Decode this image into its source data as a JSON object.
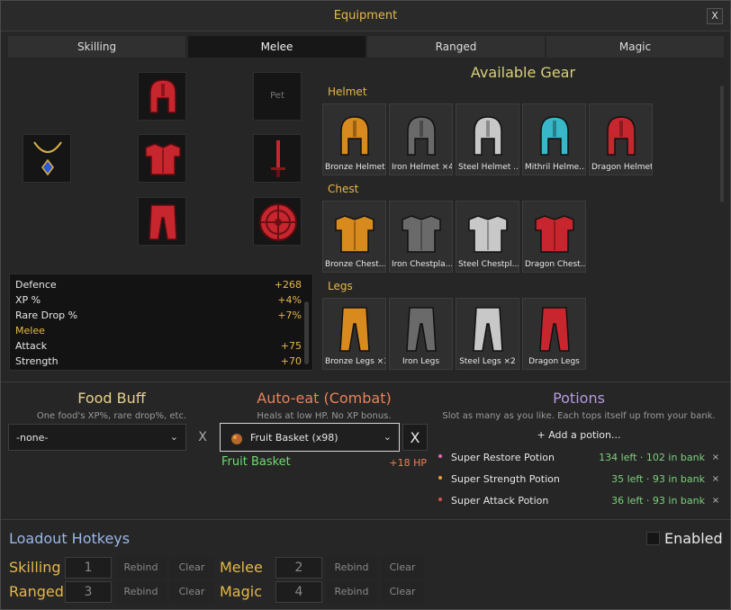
{
  "window": {
    "title": "Equipment",
    "close_label": "X"
  },
  "tabs": [
    "Skilling",
    "Melee",
    "Ranged",
    "Magic"
  ],
  "active_tab": "Melee",
  "equipped": {
    "pet_label": "Pet"
  },
  "stats": [
    {
      "label": "Defence",
      "value": "+268",
      "highlight": false
    },
    {
      "label": "XP %",
      "value": "+4%",
      "highlight": false
    },
    {
      "label": "Rare Drop %",
      "value": "+7%",
      "highlight": false
    },
    {
      "label": "Melee",
      "value": "",
      "highlight": true
    },
    {
      "label": "Attack",
      "value": "+75",
      "highlight": false
    },
    {
      "label": "Strength",
      "value": "+70",
      "highlight": false
    }
  ],
  "available_gear": {
    "title": "Available Gear",
    "categories": [
      {
        "name": "Helmet",
        "items": [
          {
            "name": "Bronze Helmet",
            "color": "#d98a1e"
          },
          {
            "name": "Iron Helmet ×4",
            "color": "#6a6a6a"
          },
          {
            "name": "Steel Helmet ...",
            "color": "#c8c8c8"
          },
          {
            "name": "Mithril Helme...",
            "color": "#38b7c8"
          },
          {
            "name": "Dragon Helmet",
            "color": "#c8262e"
          }
        ]
      },
      {
        "name": "Chest",
        "items": [
          {
            "name": "Bronze Chest...",
            "color": "#d98a1e"
          },
          {
            "name": "Iron Chestpla...",
            "color": "#6a6a6a"
          },
          {
            "name": "Steel Chestpl...",
            "color": "#c8c8c8"
          },
          {
            "name": "Dragon Chest...",
            "color": "#c8262e"
          }
        ]
      },
      {
        "name": "Legs",
        "items": [
          {
            "name": "Bronze Legs ×3",
            "color": "#d98a1e"
          },
          {
            "name": "Iron Legs",
            "color": "#6a6a6a"
          },
          {
            "name": "Steel Legs ×2",
            "color": "#c8c8c8"
          },
          {
            "name": "Dragon Legs",
            "color": "#c8262e"
          }
        ]
      }
    ]
  },
  "food_buff": {
    "title": "Food Buff",
    "subtitle": "One food's XP%, rare drop%, etc.",
    "selected": "-none-",
    "clear_label": "X"
  },
  "auto_eat": {
    "title": "Auto-eat (Combat)",
    "subtitle": "Heals at low HP. No XP bonus.",
    "selected": "Fruit Basket (x98)",
    "clear_label": "X",
    "food_name": "Fruit Basket",
    "heal": "+18 HP"
  },
  "potions": {
    "title": "Potions",
    "subtitle": "Slot as many as you like. Each tops itself up from your bank.",
    "add_label": "+ Add a potion...",
    "items": [
      {
        "name": "Super Restore Potion",
        "info": "134 left · 102 in bank",
        "color": "#e06aa8"
      },
      {
        "name": "Super Strength Potion",
        "info": "35 left · 93 in bank",
        "color": "#e0a040"
      },
      {
        "name": "Super Attack Potion",
        "info": "36 left · 93 in bank",
        "color": "#d85050"
      }
    ],
    "remove_label": "×"
  },
  "hotkeys": {
    "title": "Loadout Hotkeys",
    "enabled_label": "Enabled",
    "enabled": false,
    "rebind_label": "Rebind",
    "clear_label": "Clear",
    "rows": [
      {
        "name": "Skilling",
        "key": "1"
      },
      {
        "name": "Melee",
        "key": "2"
      },
      {
        "name": "Ranged",
        "key": "3"
      },
      {
        "name": "Magic",
        "key": "4"
      }
    ]
  },
  "colors": {
    "accent_gold": "#e6b84a",
    "food_title": "#e6d08a",
    "auto_eat_title": "#e8825a",
    "potions_title": "#b89ae0",
    "fruit_green": "#6edc6e",
    "heal_red": "#e8825a",
    "hotkeys_title": "#9ab8e8"
  }
}
